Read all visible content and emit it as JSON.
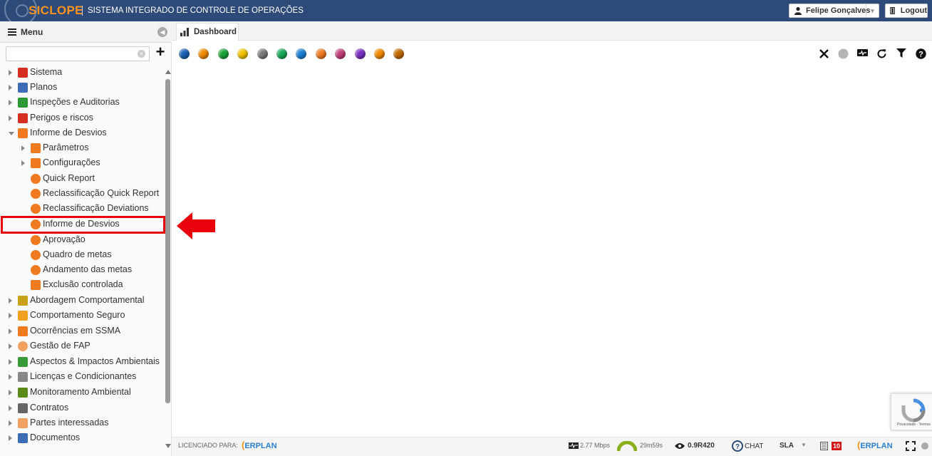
{
  "header": {
    "brand": "SICLOPE",
    "subtitle": "SISTEMA INTEGRADO DE CONTROLE DE OPERAÇÕES",
    "user": "Felipe Gonçalves",
    "logout": "Logout",
    "brand_color": "#f7931e",
    "bar_color": "#2d4a78"
  },
  "sidebar": {
    "menu_title": "Menu",
    "search": {
      "value": "",
      "placeholder": ""
    },
    "items": [
      {
        "label": "Sistema",
        "icon": "gear-icon"
      },
      {
        "label": "Planos",
        "icon": "calendar-icon"
      },
      {
        "label": "Inspeções e Auditorias",
        "icon": "clipboard-check-icon"
      },
      {
        "label": "Perigos e riscos",
        "icon": "warning-icon"
      },
      {
        "label": "Informe de Desvios",
        "icon": "folder-open-icon"
      },
      {
        "label": "Parâmetros",
        "icon": "gear-icon"
      },
      {
        "label": "Configurações",
        "icon": "sliders-icon"
      },
      {
        "label": "Quick Report",
        "icon": "phone-icon"
      },
      {
        "label": "Reclassificação Quick Report",
        "icon": "shuffle-icon"
      },
      {
        "label": "Reclassificação Deviations",
        "icon": "shuffle-icon"
      },
      {
        "label": "Informe de Desvios",
        "icon": "phone-icon"
      },
      {
        "label": "Aprovação",
        "icon": "thumbs-up-icon"
      },
      {
        "label": "Quadro de metas",
        "icon": "table-icon"
      },
      {
        "label": "Andamento das metas",
        "icon": "target-icon"
      },
      {
        "label": "Exclusão controlada",
        "icon": "bin-icon"
      },
      {
        "label": "Abordagem Comportamental",
        "icon": "diamond-icon"
      },
      {
        "label": "Comportamento Seguro",
        "icon": "hardhat-icon"
      },
      {
        "label": "Ocorrências em SSMA",
        "icon": "falling-person-icon"
      },
      {
        "label": "Gestão de FAP",
        "icon": "coin-icon"
      },
      {
        "label": "Aspectos & Impactos Ambientais",
        "icon": "recycle-icon"
      },
      {
        "label": "Licenças e Condicionantes",
        "icon": "document-icon"
      },
      {
        "label": "Monitoramento Ambiental",
        "icon": "tree-icon"
      },
      {
        "label": "Contratos",
        "icon": "scales-icon"
      },
      {
        "label": "Partes interessadas",
        "icon": "people-icon"
      },
      {
        "label": "Documentos",
        "icon": "files-icon"
      }
    ]
  },
  "tabs": [
    {
      "label": "Dashboard",
      "icon": "bar-chart-icon"
    }
  ],
  "status_dots": [
    "#1a5fb4",
    "#f08a00",
    "#1aa33a",
    "#f2c200",
    "#7a7a7a",
    "#18a558",
    "#1c7fd6",
    "#f07a20",
    "#c0407a",
    "#7a2fc0",
    "#f08a00",
    "#c06a00"
  ],
  "toolbar": [
    "close-icon",
    "circle-icon",
    "monitor-icon",
    "refresh-icon",
    "filter-icon",
    "help-icon"
  ],
  "footer": {
    "licensed_label": "LICENCIADO PARA:",
    "licensee": "ERPLAN",
    "speed": "2.77 Mbps",
    "timer": "29m59s",
    "version": "0.9R420",
    "chat": "CHAT",
    "sla": "SLA",
    "notifications": "10",
    "brand2": "ERPLAN"
  },
  "recaptcha": {
    "text": "Privacidade - Termos"
  }
}
